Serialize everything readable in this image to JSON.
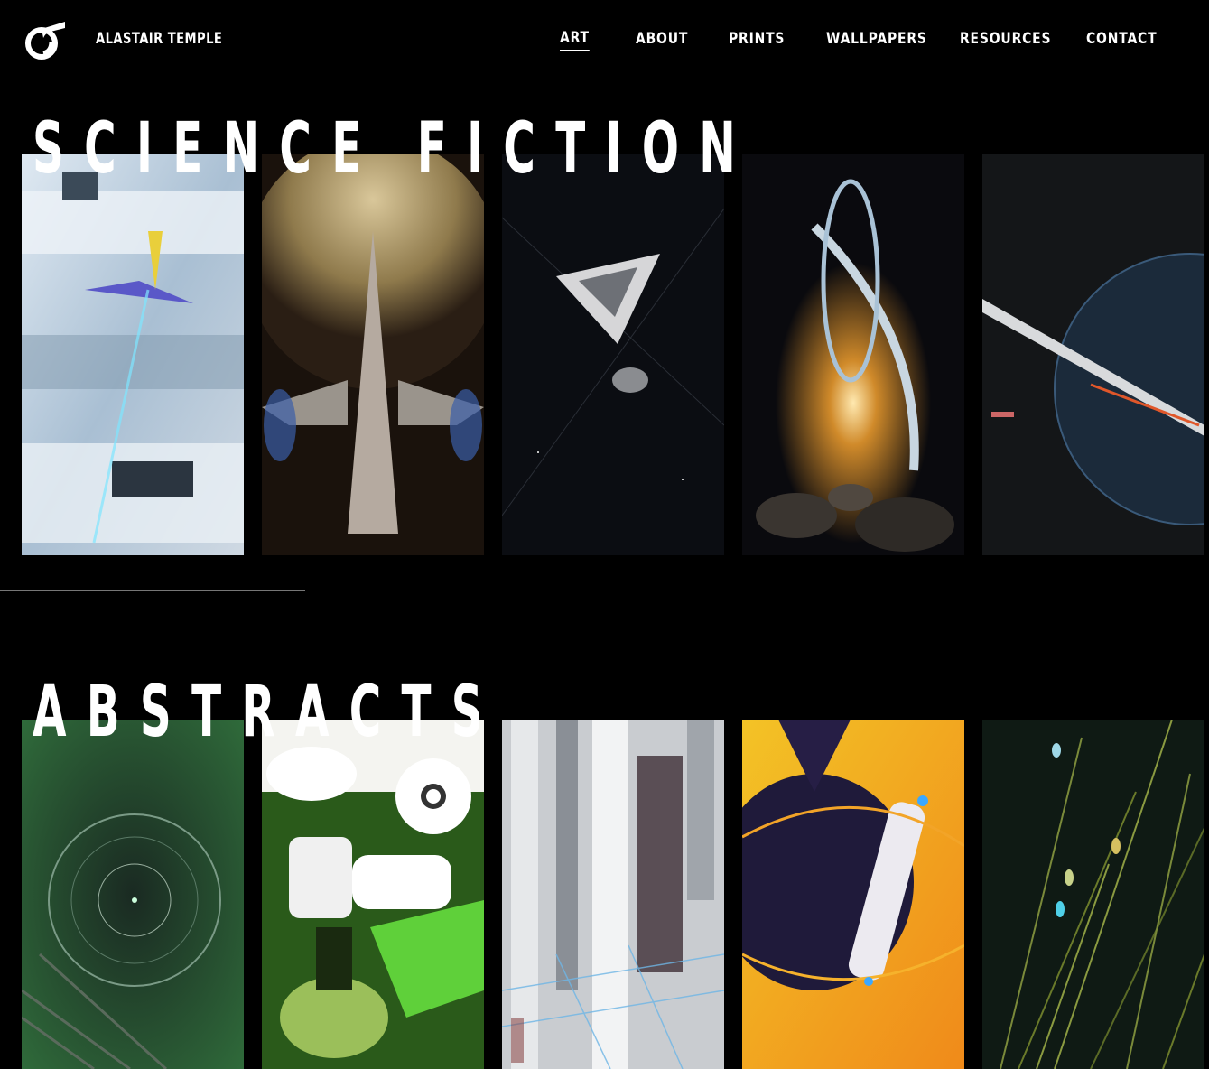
{
  "header": {
    "logo_icon": "at-logo-icon",
    "brand": "ALASTAIR TEMPLE",
    "nav": [
      {
        "label": "ART",
        "active": true
      },
      {
        "label": "ABOUT"
      },
      {
        "label": "PRINTS"
      },
      {
        "label": "WALLPAPERS"
      },
      {
        "label": "RESOURCES"
      },
      {
        "label": "CONTACT"
      }
    ]
  },
  "sections": [
    {
      "title": "SCIENCE FICTION",
      "thumbnails": 5
    },
    {
      "title": "ABSTRACTS",
      "thumbnails": 5
    }
  ],
  "colors": {
    "background": "#000000",
    "text": "#ffffff",
    "divider": "#777777"
  }
}
